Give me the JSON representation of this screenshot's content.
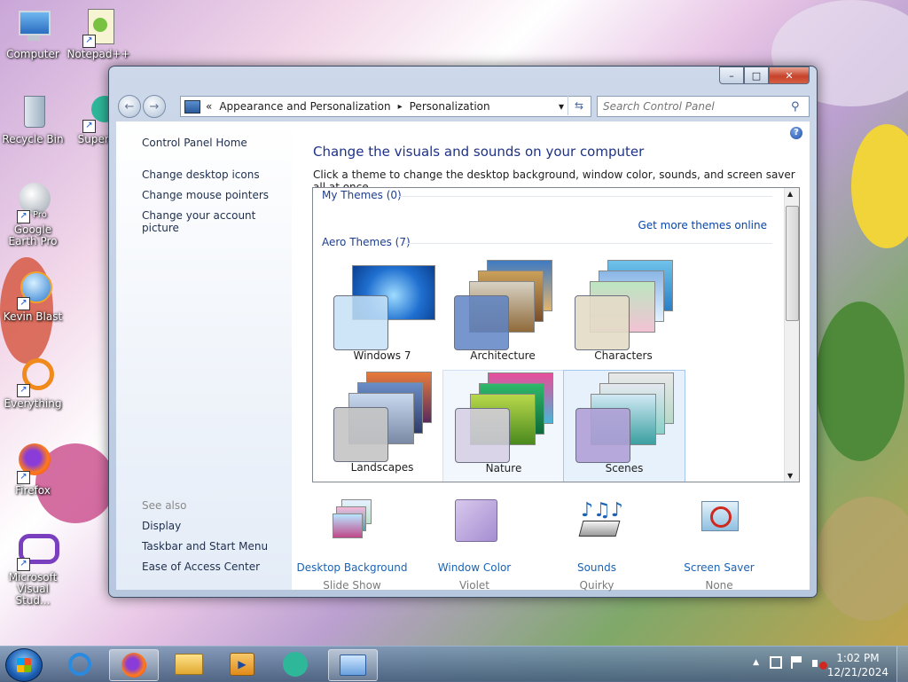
{
  "desktop": {
    "icons": [
      {
        "label": "Computer"
      },
      {
        "label": "Notepad++"
      },
      {
        "label": "Recycle Bin"
      },
      {
        "label": "Superm"
      },
      {
        "label": "Google Earth Pro"
      },
      {
        "label": "Kevin Blast"
      },
      {
        "label": "Everything"
      },
      {
        "label": "Firefox"
      },
      {
        "label": "Microsoft Visual Stud..."
      }
    ],
    "google_earth_badge": "Pro"
  },
  "window": {
    "caption": {
      "minimize": "–",
      "maximize": "□",
      "close": "✕"
    },
    "nav": {
      "back": "←",
      "forward": "→"
    },
    "address": {
      "chevron": "«",
      "crumb1": "Appearance and Personalization",
      "separator": "▸",
      "crumb2": "Personalization",
      "dropdown": "▾",
      "refresh": "⇆"
    },
    "search": {
      "placeholder": "Search Control Panel",
      "icon": "⚲"
    },
    "sidebar": {
      "home": "Control Panel Home",
      "links": [
        "Change desktop icons",
        "Change mouse pointers",
        "Change your account picture"
      ],
      "see_also_label": "See also",
      "see_also": [
        "Display",
        "Taskbar and Start Menu",
        "Ease of Access Center"
      ]
    },
    "main": {
      "title": "Change the visuals and sounds on your computer",
      "subtitle": "Click a theme to change the desktop background, window color, sounds, and screen saver all at once.",
      "help": "?",
      "my_themes": "My Themes (0)",
      "more_themes": "Get more themes online",
      "aero_themes": "Aero Themes (7)",
      "themes": [
        {
          "name": "Windows 7"
        },
        {
          "name": "Architecture"
        },
        {
          "name": "Characters"
        },
        {
          "name": "Landscapes"
        },
        {
          "name": "Nature"
        },
        {
          "name": "Scenes"
        }
      ],
      "bottom": [
        {
          "name": "Desktop Background",
          "value": "Slide Show"
        },
        {
          "name": "Window Color",
          "value": "Violet"
        },
        {
          "name": "Sounds",
          "value": "Quirky"
        },
        {
          "name": "Screen Saver",
          "value": "None"
        }
      ]
    }
  },
  "taskbar": {
    "time": "1:02 PM",
    "date": "12/21/2024",
    "tray_arrow": "▲"
  },
  "colors": {
    "accent": "#1e3287",
    "link": "#1a63b5",
    "selected": "#e7f1fb"
  }
}
